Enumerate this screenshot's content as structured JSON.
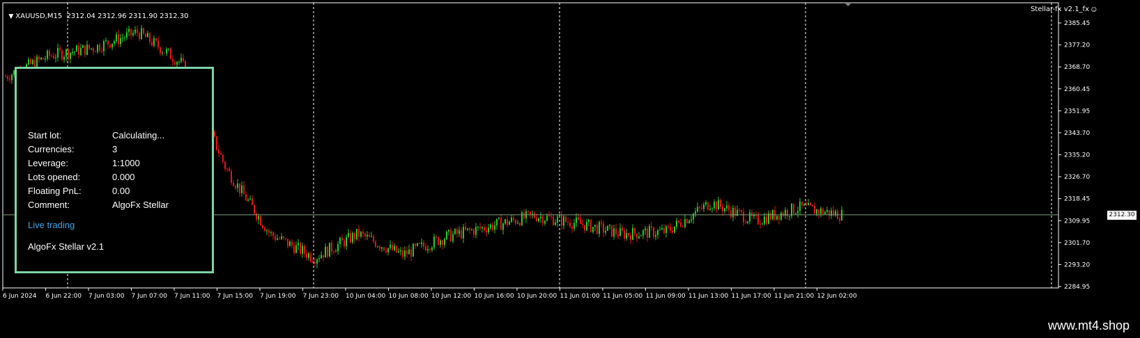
{
  "header": {
    "symbol": "XAUUSD,M15",
    "ohlc": "2312.04 2312.96 2311.90 2312.30",
    "ea_name": "Stellar-fx v2.1_fx"
  },
  "panel": {
    "rows": [
      {
        "label": "Start lot:",
        "value": "Calculating..."
      },
      {
        "label": "Currencies:",
        "value": "3"
      },
      {
        "label": "Leverage:",
        "value": "1:1000"
      },
      {
        "label": "Lots opened:",
        "value": "0.000"
      },
      {
        "label": "Floating PnL:",
        "value": "0.00"
      },
      {
        "label": "Comment:",
        "value": "AlgoFx Stellar"
      }
    ],
    "status": "Live trading",
    "version": "AlgoFx Stellar v2.1"
  },
  "price_scale": [
    "2385.45",
    "2377.20",
    "2368.70",
    "2360.45",
    "2351.95",
    "2343.70",
    "2335.20",
    "2326.70",
    "2318.45",
    "2309.95",
    "2301.70",
    "2293.20",
    "2284.95"
  ],
  "current_price": "2312.30",
  "time_scale": [
    "6 Jun 2024",
    "6 Jun 22:00",
    "7 Jun 03:00",
    "7 Jun 07:00",
    "7 Jun 11:00",
    "7 Jun 15:00",
    "7 Jun 19:00",
    "7 Jun 23:00",
    "10 Jun 04:00",
    "10 Jun 08:00",
    "10 Jun 12:00",
    "10 Jun 16:00",
    "10 Jun 20:00",
    "11 Jun 01:00",
    "11 Jun 05:00",
    "11 Jun 09:00",
    "11 Jun 13:00",
    "11 Jun 17:00",
    "11 Jun 21:00",
    "12 Jun 02:00"
  ],
  "colors": {
    "bull": "#2bc92b",
    "bear": "#e51515",
    "grid": "#ffffff",
    "bid_line": "#7fa37f",
    "panel_border": "#7fd4a4",
    "link": "#3aa6e8"
  },
  "chart_data": {
    "type": "candlestick",
    "ylim": [
      2284.95,
      2385.45
    ],
    "key_closes": [
      {
        "x": "6 Jun 2024",
        "y": 2365
      },
      {
        "x": "6 Jun 22:00",
        "y": 2373
      },
      {
        "x": "7 Jun 03:00",
        "y": 2376
      },
      {
        "x": "7 Jun 07:00",
        "y": 2382
      },
      {
        "x": "7 Jun 11:00",
        "y": 2370
      },
      {
        "x": "7 Jun 15:00",
        "y": 2330
      },
      {
        "x": "7 Jun 19:00",
        "y": 2305
      },
      {
        "x": "7 Jun 23:00",
        "y": 2296
      },
      {
        "x": "10 Jun 04:00",
        "y": 2305
      },
      {
        "x": "10 Jun 08:00",
        "y": 2297
      },
      {
        "x": "10 Jun 12:00",
        "y": 2304
      },
      {
        "x": "10 Jun 16:00",
        "y": 2308
      },
      {
        "x": "10 Jun 20:00",
        "y": 2312
      },
      {
        "x": "11 Jun 01:00",
        "y": 2309
      },
      {
        "x": "11 Jun 05:00",
        "y": 2305
      },
      {
        "x": "11 Jun 09:00",
        "y": 2306
      },
      {
        "x": "11 Jun 13:00",
        "y": 2317
      },
      {
        "x": "11 Jun 17:00",
        "y": 2310
      },
      {
        "x": "11 Jun 21:00",
        "y": 2315
      },
      {
        "x": "12 Jun 02:00",
        "y": 2312.3
      }
    ]
  }
}
